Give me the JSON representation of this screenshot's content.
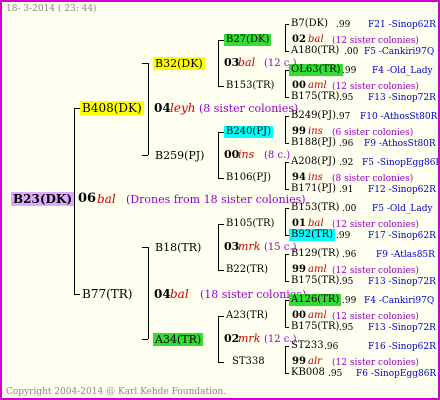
{
  "header": "18- 3-2014 ( 23: 44)",
  "footer": "Copyright 2004-2014 @ Karl Kehde Foundation.",
  "colors": {
    "frame": "#cc00cc",
    "bg": "#fffff0",
    "root_box": "#ddaaff",
    "yellow": "#ffff00",
    "green": "#33dd33",
    "cyan": "#00ffff",
    "accent_red": "#cc0000",
    "sister": "#9900cc",
    "link_blue": "#0000cc"
  },
  "root": {
    "name": "B23(DK)",
    "gen": "06",
    "bal": "bal",
    "note": "(Drones from 18 sister colonies)"
  },
  "level1": [
    {
      "name": "B408(DK)",
      "gen": "04",
      "bal": "leyh",
      "note": "(8 sister colonies)"
    },
    {
      "name": "B77(TR)",
      "gen": "04",
      "bal": "bal",
      "note": "(18 sister colonies)"
    }
  ],
  "level2": [
    {
      "name": "B32(DK)",
      "gen": "03",
      "bal": "bal",
      "note": "(12 c.)"
    },
    {
      "name": "B259(PJ)",
      "gen": "00",
      "bal": "ins",
      "note": "(8 c.)"
    },
    {
      "name": "B18(TR)",
      "gen": "03",
      "bal": "mrk",
      "note": "(15 c.)"
    },
    {
      "name": "A34(TR)",
      "gen": "02",
      "bal": "mrk",
      "note": "(12 c.)"
    }
  ],
  "level3": [
    {
      "name": "B27(DK)",
      "gen": "02",
      "bal": "bal",
      "note": "(12 sister colonies)"
    },
    {
      "name": "B153(TR)",
      "gen": "00",
      "bal": "aml",
      "note": "(12 sister colonies)"
    },
    {
      "name": "B240(PJ)",
      "gen": "99",
      "bal": "ins",
      "note": "(6 sister colonies)"
    },
    {
      "name": "B106(PJ)",
      "gen": "94",
      "bal": "ins",
      "note": "(8 sister colonies)"
    },
    {
      "name": "B105(TR)",
      "gen": "01",
      "bal": "bal",
      "note": "(12 sister colonies)"
    },
    {
      "name": "B22(TR)",
      "gen": "99",
      "bal": "aml",
      "note": "(12 sister colonies)"
    },
    {
      "name": "A23(TR)",
      "gen": "00",
      "bal": "aml",
      "note": "(12 sister colonies)"
    },
    {
      "name": "ST338",
      "gen": "99",
      "bal": "alr",
      "note": "(12 sister colonies)"
    }
  ],
  "leaves": [
    {
      "name": "B7(DK)",
      "val": ".99",
      "link": "F21 -Sinop62R"
    },
    {
      "name": "A180(TR)",
      "val": ".00",
      "link": "F5 -Cankiri97Q"
    },
    {
      "name": "OL63(TR)",
      "val": ".99",
      "link": "F4 -Old_Lady"
    },
    {
      "name": "B175(TR)",
      "val": ".95",
      "link": "F13 -Sinop72R"
    },
    {
      "name": "B249(PJ)",
      "val": ".97",
      "link": "F10 -AthosSt80R"
    },
    {
      "name": "B188(PJ)",
      "val": ".96",
      "link": "F9 -AthosSt80R"
    },
    {
      "name": "A208(PJ)",
      "val": ".92",
      "link": "F5 -SinopEgg86R"
    },
    {
      "name": "B171(PJ)",
      "val": ".91",
      "link": "F12 -Sinop62R"
    },
    {
      "name": "B153(TR)",
      "val": ".00",
      "link": "F5 -Old_Lady"
    },
    {
      "name": "B92(TR)",
      "val": ".99",
      "link": "F17 -Sinop62R"
    },
    {
      "name": "B129(TR)",
      "val": ".96",
      "link": "F9 -Atlas85R"
    },
    {
      "name": "B175(TR)",
      "val": ".95",
      "link": "F13 -Sinop72R"
    },
    {
      "name": "A126(TR)",
      "val": ".99",
      "link": "F4 -Cankiri97Q"
    },
    {
      "name": "B175(TR)",
      "val": ".95",
      "link": "F13 -Sinop72R"
    },
    {
      "name": "ST233",
      "val": ".96",
      "link": "F16 -Sinop62R"
    },
    {
      "name": "KB008",
      "val": ".95",
      "link": "F6 -SinopEgg86R"
    }
  ]
}
